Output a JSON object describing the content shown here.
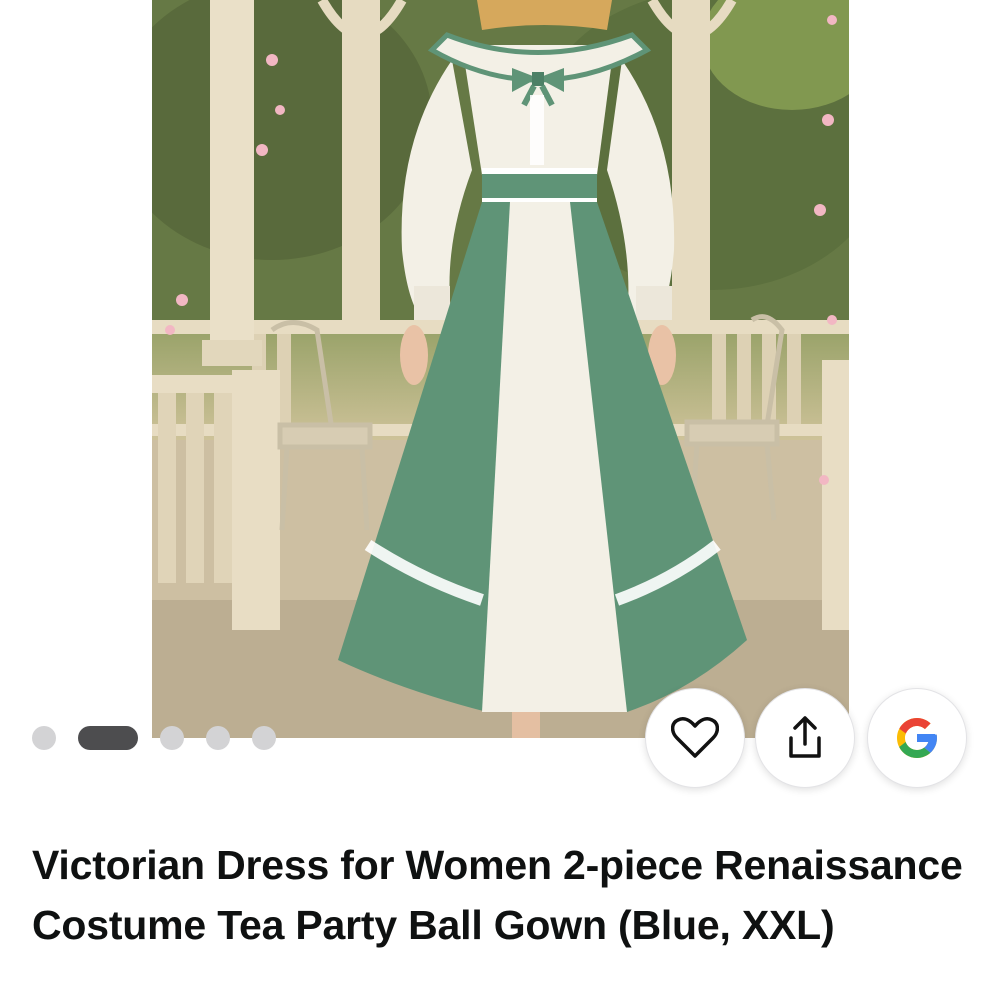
{
  "product": {
    "title": "Victorian Dress for Women 2-piece Renaissance Costume Tea Party Ball Gown (Blue, XXL)",
    "image_alt": "Woman in a white and sage green Victorian dress with sailor collar, bow and lace trim standing in a garden gazebo"
  },
  "carousel": {
    "total": 5,
    "active_index": 1
  },
  "actions": {
    "favorite_icon": "heart-icon",
    "share_icon": "share-icon",
    "google_icon": "google-logo-icon"
  },
  "colors": {
    "dress_green": "#5f9477",
    "dress_white": "#f3f0e6",
    "dot_inactive": "#d3d3d5",
    "dot_active": "#4d4d4f",
    "title_text": "#0f1111",
    "google_blue": "#4285F4",
    "google_red": "#EA4335",
    "google_yellow": "#FBBC05",
    "google_green": "#34A853"
  }
}
